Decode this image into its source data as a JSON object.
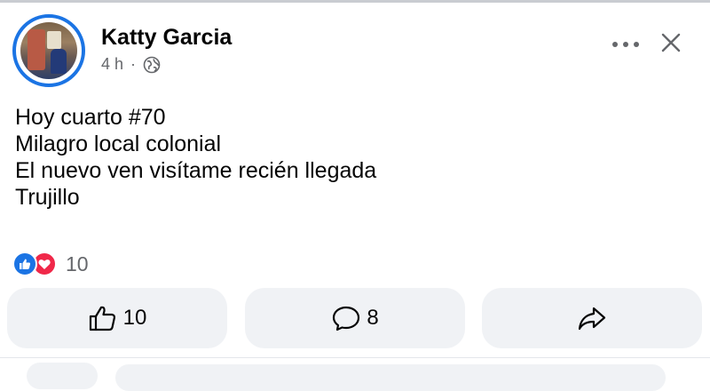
{
  "post": {
    "author": "Katty Garcia",
    "time": "4 h",
    "separator": "·",
    "audience_icon": "globe-icon",
    "lines": [
      "Hoy cuarto #70",
      "Milagro local colonial",
      "El nuevo ven visítame recién llegada",
      "Trujillo"
    ]
  },
  "reactions": {
    "types": [
      "like",
      "love"
    ],
    "count": "10"
  },
  "actions": {
    "like_count": "10",
    "comment_count": "8"
  },
  "colors": {
    "accent": "#1b74e4",
    "love": "#f02849",
    "button_bg": "#f0f2f5",
    "secondary_text": "#65676b"
  }
}
